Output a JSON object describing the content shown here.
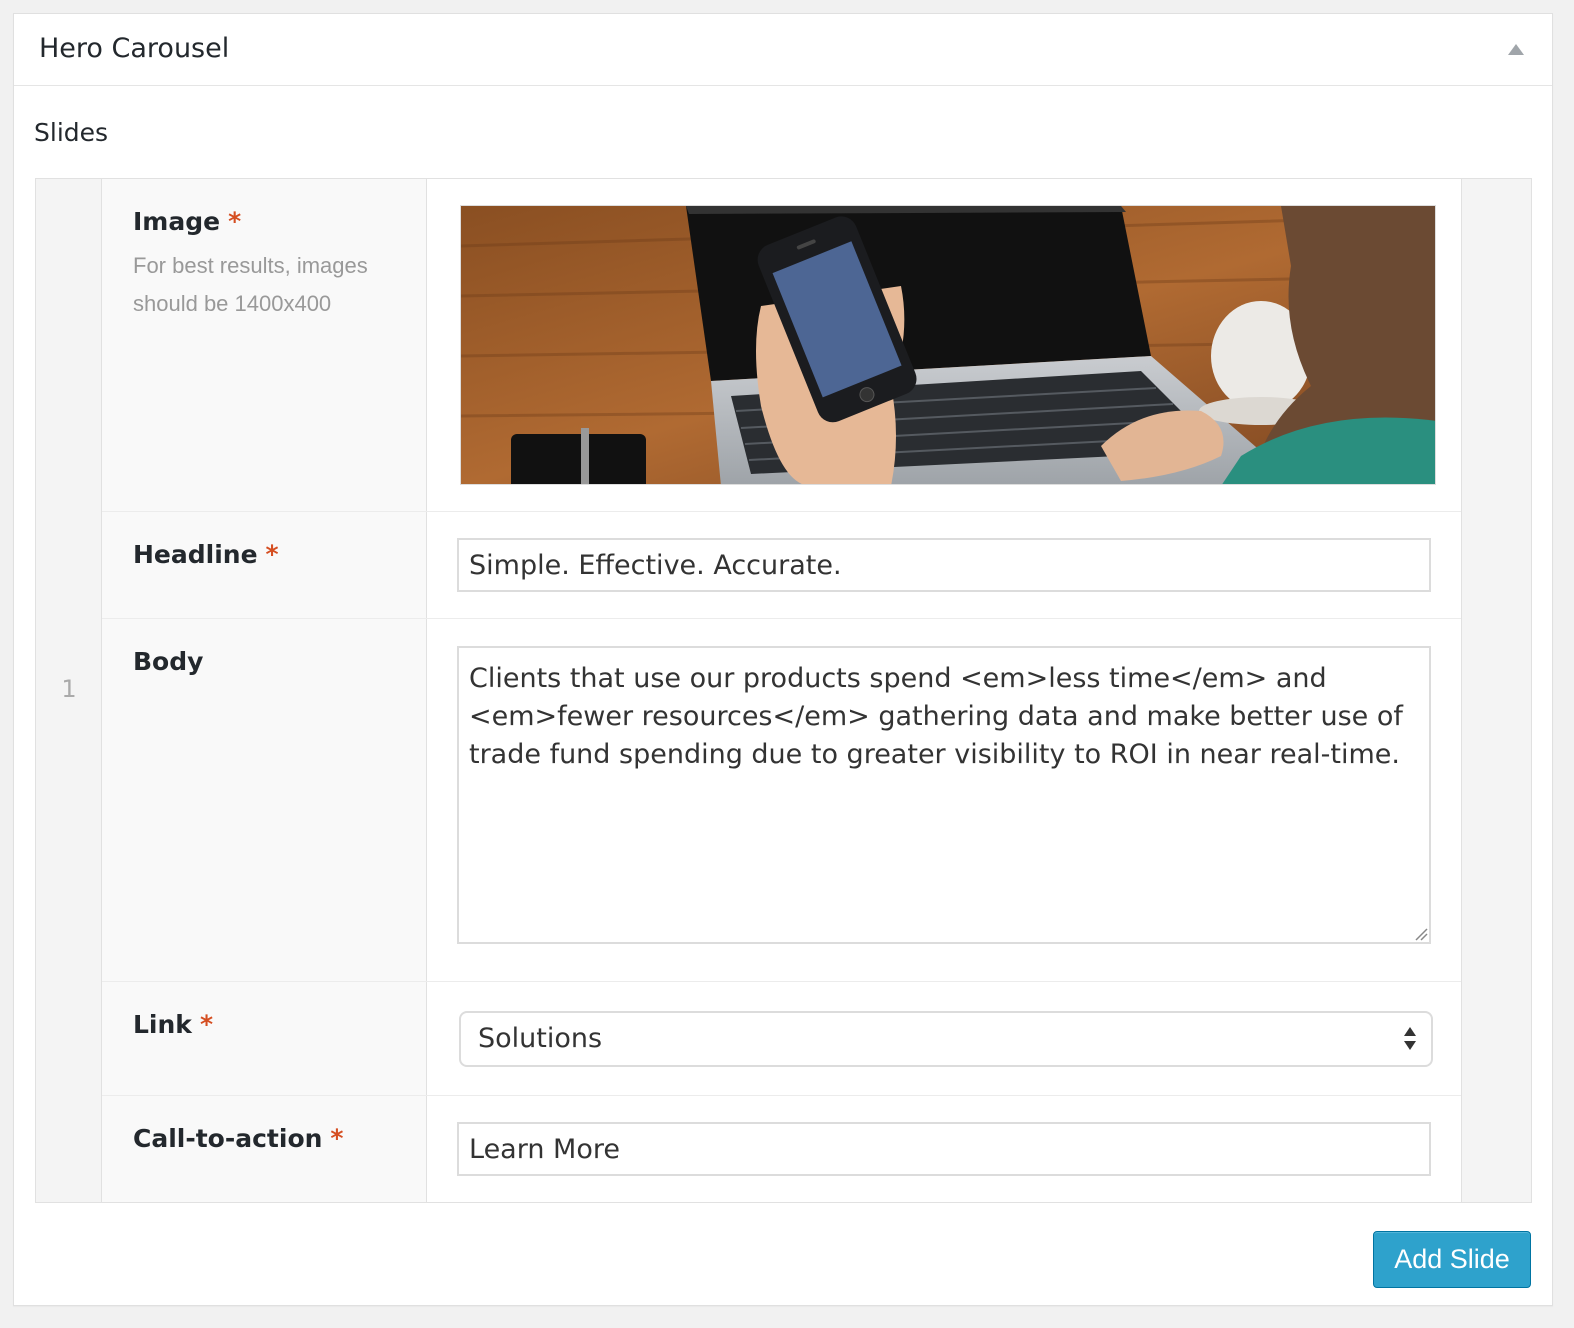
{
  "panel": {
    "title": "Hero Carousel"
  },
  "slides": {
    "label": "Slides",
    "items": [
      {
        "order": "1",
        "fields": {
          "image": {
            "label": "Image",
            "required_mark": "*",
            "description": "For best results, images should be 1400x400"
          },
          "headline": {
            "label": "Headline",
            "required_mark": "*",
            "value": "Simple. Effective. Accurate."
          },
          "body": {
            "label": "Body",
            "value": "Clients that use our products spend <em>less time</em> and <em>fewer resources</em> gathering data and make better use of trade fund spending due to greater visibility to ROI in near real-time."
          },
          "link": {
            "label": "Link",
            "required_mark": "*",
            "selected": "Solutions"
          },
          "cta": {
            "label": "Call-to-action",
            "required_mark": "*",
            "value": "Learn More"
          }
        }
      }
    ]
  },
  "actions": {
    "add_slide_label": "Add Slide"
  },
  "colors": {
    "primary_button": "#2ea2cc",
    "required": "#d54e21"
  }
}
